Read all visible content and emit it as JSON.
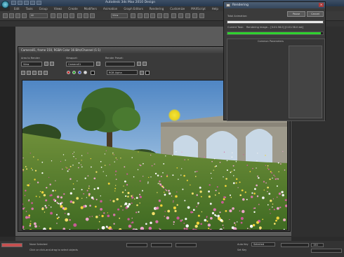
{
  "app": {
    "title": "Autodesk 3ds Max  2010  Design"
  },
  "menus": [
    "Edit",
    "Tools",
    "Group",
    "Views",
    "Create",
    "Modifiers",
    "Animation",
    "Graph Editors",
    "Rendering",
    "Customize",
    "MAXScript",
    "Help"
  ],
  "toolbar": {
    "selection_filter": "All",
    "view_dropdown": "View"
  },
  "rendering_dialog": {
    "title": "Rendering",
    "pause_label": "Pause",
    "cancel_label": "Cancel",
    "total_animation_label": "Total Animation:",
    "current_task_label": "Current Task:",
    "current_task_value": "Rendering image... [0:01:56.0] [0:01:38.0 est]",
    "total_progress": 1.0,
    "task_progress": 0.98,
    "group_title": "Common Parameters",
    "colors": {
      "task_fill": "#2fd22f"
    }
  },
  "frame_window": {
    "title": "Camera01, frame 150, RGBA Color 16 Bits/Channel (1:1)",
    "area_label": "Area to Render:",
    "area_value": "View",
    "viewport_label": "Viewport:",
    "viewport_value": "Camera01",
    "preset_label": "Render Preset:",
    "preset_value": "",
    "renderer_label": "Renderer:",
    "renderer_value": "Production",
    "channel_value": "RGB Alpha"
  },
  "status": {
    "none_selected": "None Selected",
    "prompt": "Click or click-and-drag to select objects",
    "selected_value": "Selected",
    "autokey_label": "Auto Key",
    "setkey_label": "Set Key",
    "frame_value": "150"
  }
}
